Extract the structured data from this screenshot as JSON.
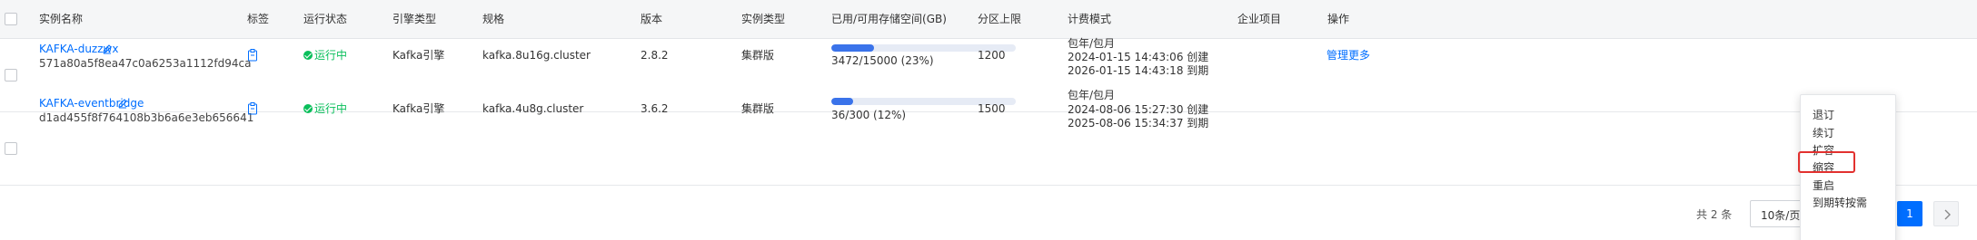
{
  "table": {
    "headers": {
      "name": "实例名称",
      "tag": "标签",
      "status": "运行状态",
      "engine": "引擎类型",
      "spec": "规格",
      "version": "版本",
      "instance_type": "实例类型",
      "storage": "已用/可用存储空间(GB)",
      "partition": "分区上限",
      "billing": "计费模式",
      "project": "企业项目",
      "actions": "操作"
    },
    "rows": [
      {
        "name": "KAFKA-duzzwx",
        "id": "571a80a5f8ea47c0a6253a1112fd94ca",
        "status": "运行中",
        "engine": "Kafka引擎",
        "spec": "kafka.8u16g.cluster",
        "version": "2.8.2",
        "instance_type": "集群版",
        "storage_text": "3472/15000  (23%)",
        "storage_fraction": 0.23,
        "partition": "1200",
        "billing_mode": "包年/包月",
        "created": "2024-01-15 14:43:06 创建",
        "expires": "2026-01-15 14:43:18 到期",
        "action_manage": "管理",
        "action_more": "更多"
      },
      {
        "name": "KAFKA-eventbridge",
        "id": "d1ad455f8f764108b3b6a6e3eb656641",
        "status": "运行中",
        "engine": "Kafka引擎",
        "spec": "kafka.4u8g.cluster",
        "version": "3.6.2",
        "instance_type": "集群版",
        "storage_text": "36/300  (12%)",
        "storage_fraction": 0.12,
        "partition": "1500",
        "billing_mode": "包年/包月",
        "created": "2024-08-06 15:27:30 创建",
        "expires": "2025-08-06 15:34:37 到期"
      }
    ]
  },
  "pagination": {
    "total": "共 2 条",
    "page_size": "10条/页",
    "current_page": "1"
  },
  "more_menu": {
    "items": [
      "退订",
      "续订",
      "扩容",
      "缩容",
      "重启",
      "到期转按需"
    ]
  },
  "colors": {
    "accent": "#006eff",
    "running": "#0abf5b",
    "highlight": "#e2312f"
  }
}
